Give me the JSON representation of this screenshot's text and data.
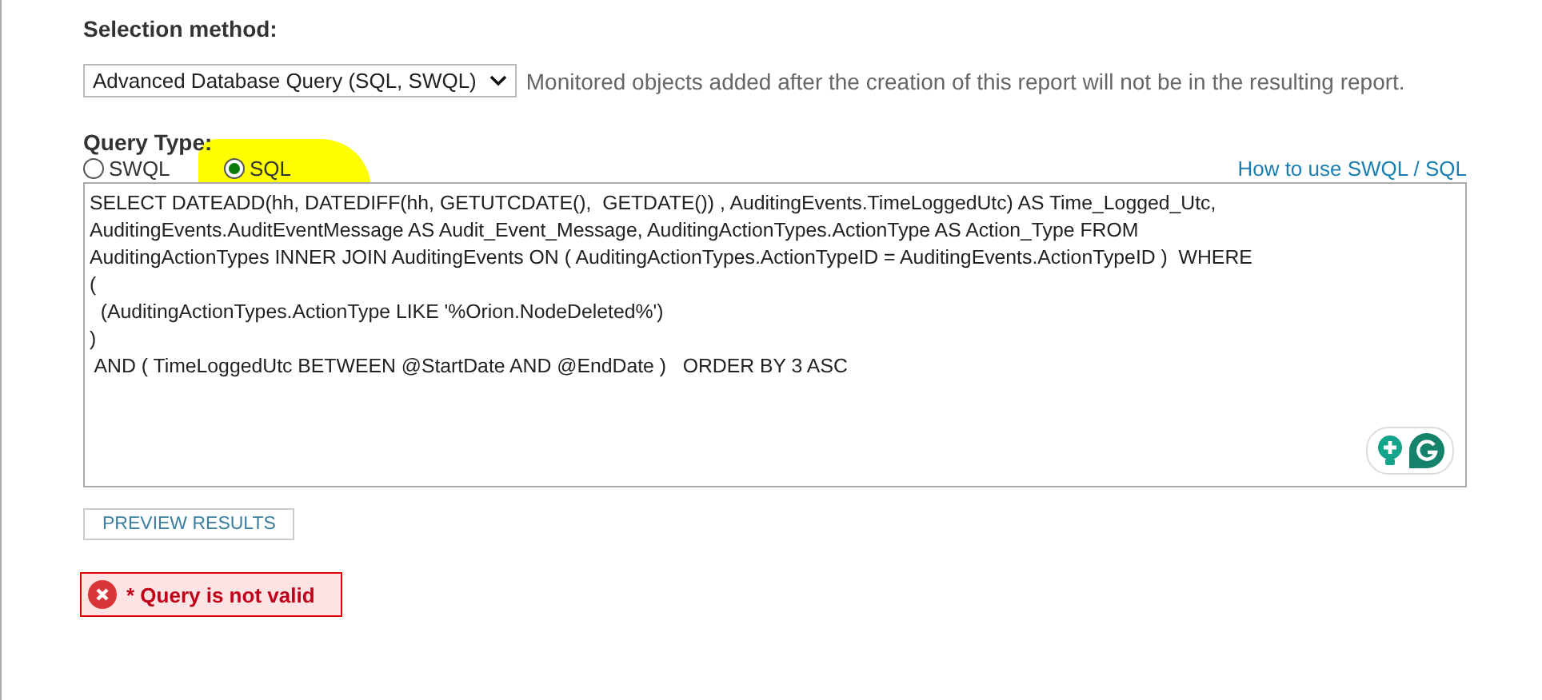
{
  "selection_method": {
    "label": "Selection method:",
    "value": "Advanced Database Query (SQL, SWQL)",
    "note": "Monitored objects added after the creation of this report will not be in the resulting report."
  },
  "query_type": {
    "label": "Query Type:",
    "options": [
      {
        "label": "SWQL",
        "selected": false
      },
      {
        "label": "SQL",
        "selected": true,
        "highlighted": true
      }
    ],
    "help_link": "How to use SWQL / SQL"
  },
  "query": "SELECT DATEADD(hh, DATEDIFF(hh, GETUTCDATE(),  GETDATE()) , AuditingEvents.TimeLoggedUtc) AS Time_Logged_Utc,\nAuditingEvents.AuditEventMessage AS Audit_Event_Message, AuditingActionTypes.ActionType AS Action_Type FROM\nAuditingActionTypes INNER JOIN AuditingEvents ON ( AuditingActionTypes.ActionTypeID = AuditingEvents.ActionTypeID )  WHERE\n(\n  (AuditingActionTypes.ActionType LIKE '%Orion.NodeDeleted%')\n)\n AND ( TimeLoggedUtc BETWEEN @StartDate AND @EndDate )   ORDER BY 3 ASC",
  "preview_button": "PREVIEW RESULTS",
  "error": "* Query is not valid"
}
